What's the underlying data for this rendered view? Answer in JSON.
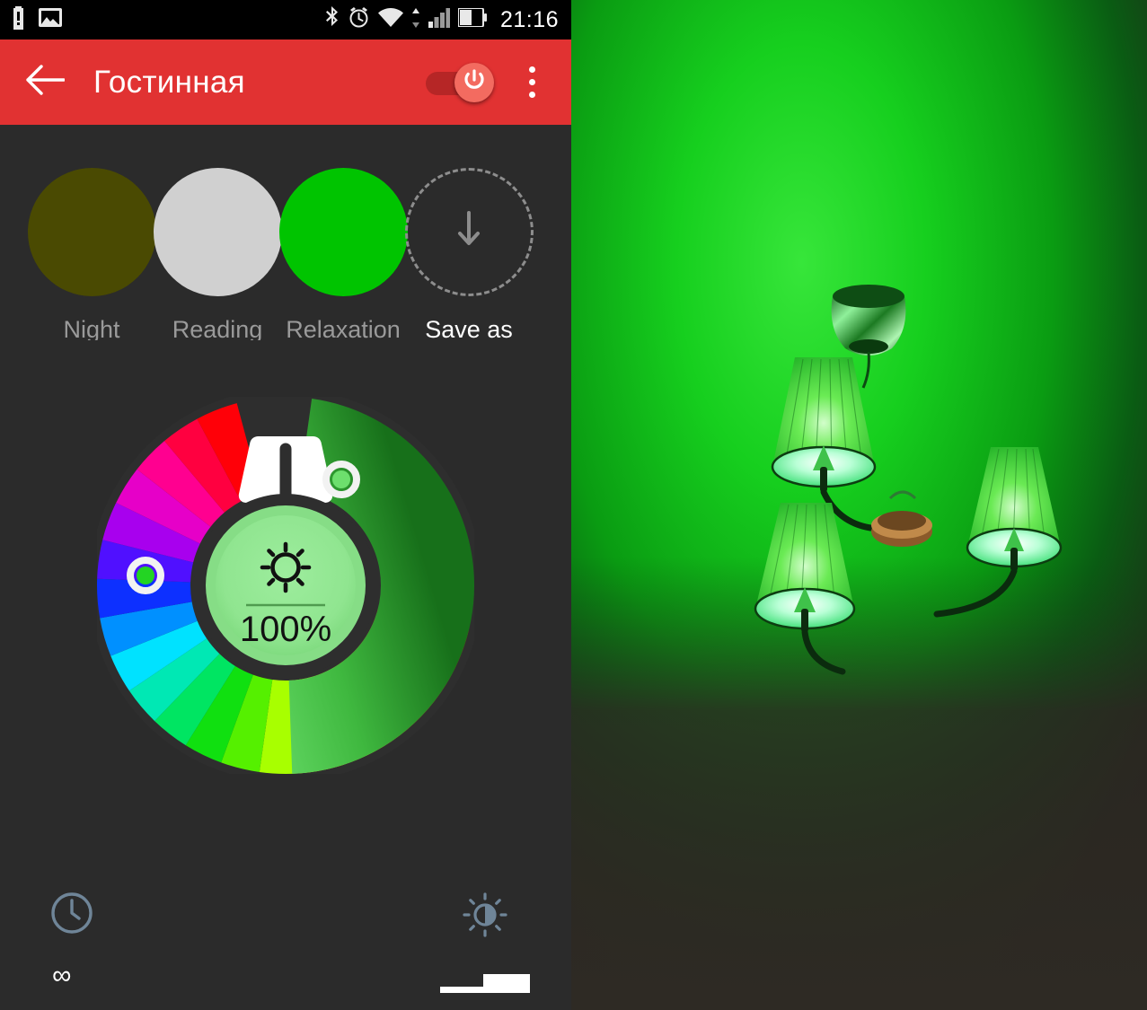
{
  "statusbar": {
    "time": "21:16",
    "left_icons": [
      "battery-alert-icon",
      "photo-icon"
    ],
    "right_icons": [
      "bluetooth-icon",
      "alarm-icon",
      "wifi-icon",
      "data-transfer-icon",
      "signal-icon",
      "battery-icon"
    ]
  },
  "appbar": {
    "back_icon": "back-arrow-icon",
    "title": "Гостинная",
    "power_toggle": {
      "state": "on",
      "icon": "power-icon",
      "track_color": "#b62626",
      "thumb_color": "#f36b60"
    },
    "overflow_icon": "overflow-menu-icon",
    "bar_color": "#e13232"
  },
  "presets": [
    {
      "label": "Night",
      "color": "#4a4a02",
      "type": "scene"
    },
    {
      "label": "Reading",
      "color": "#d0d0d0",
      "type": "scene"
    },
    {
      "label": "Relaxation",
      "color": "#00c400",
      "type": "scene"
    },
    {
      "label": "Save as",
      "color": "transparent",
      "type": "save",
      "icon": "down-arrow-icon"
    }
  ],
  "color_wheel": {
    "brightness_label": "100%",
    "brightness_icon": "sun-brightness-icon",
    "center_color": "#8fe08f",
    "white_segment_color": "#ffffff",
    "hue_handle": {
      "position": "green",
      "color": "#27d827"
    },
    "level_handle": {
      "position": "upper-right",
      "color": "#6fdf6f"
    },
    "level_arc_top_color": "#7fe07f",
    "level_arc_bottom_color": "#1b7a1b",
    "track_color": "#2e2e2e",
    "accent_arc_color": "#1769c8"
  },
  "bottom_controls": {
    "timer": {
      "icon": "clock-icon",
      "value": "∞",
      "icon_color": "#6f8598"
    },
    "brightness": {
      "icon": "brightness-contrast-icon",
      "icon_color": "#6f8598",
      "slider_value": "high"
    }
  },
  "photo": {
    "alt": "ceiling-chandelier-green-light",
    "wall_glow_color": "#1ed124",
    "wall_dark_color": "#2a2722",
    "lamp_shade_color": "#5fe84a",
    "lamp_count": 3
  }
}
